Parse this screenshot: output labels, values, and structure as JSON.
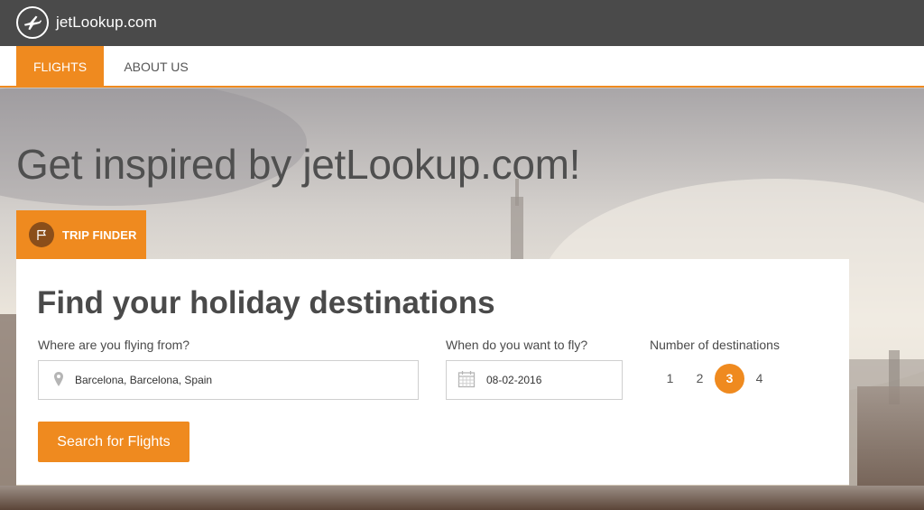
{
  "brand": {
    "name": "jetLookup.com",
    "logo_icon": "plane-icon"
  },
  "nav": {
    "items": [
      {
        "label": "FLIGHTS",
        "active": true
      },
      {
        "label": "ABOUT US",
        "active": false
      }
    ]
  },
  "hero": {
    "headline": "Get inspired by jetLookup.com!"
  },
  "trip_finder": {
    "tab_label": "TRIP FINDER",
    "tab_icon": "flag-icon",
    "title": "Find your holiday destinations",
    "from": {
      "label": "Where are you flying from?",
      "value": "Barcelona, Barcelona, Spain",
      "icon": "location-pin-icon"
    },
    "when": {
      "label": "When do you want to fly?",
      "value": "08-02-2016",
      "icon": "calendar-icon"
    },
    "destinations": {
      "label": "Number of destinations",
      "options": [
        "1",
        "2",
        "3",
        "4"
      ],
      "selected": "3"
    },
    "search_button": "Search for Flights"
  },
  "colors": {
    "accent": "#ef8a1f",
    "topbar": "#4a4a4a",
    "text": "#4a4a4a"
  }
}
